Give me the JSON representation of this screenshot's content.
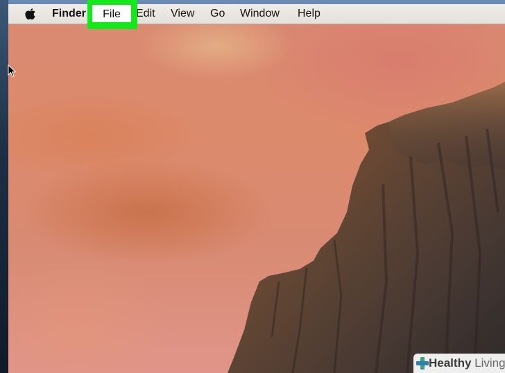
{
  "menubar": {
    "apple_icon": "apple-logo-icon",
    "app_name": "Finder",
    "items": [
      "File",
      "Edit",
      "View",
      "Go",
      "Window",
      "Help"
    ],
    "highlighted_item": "File",
    "highlight_color": "#12e81a"
  },
  "desktop": {
    "wallpaper_colors": [
      "#d98a72",
      "#e0958a",
      "#3a2a24"
    ]
  },
  "cursor": {
    "icon": "arrow-cursor-icon"
  },
  "watermark": {
    "brand_part1": "Healthy",
    "brand_part2": "Living",
    "icon": "plus-cross-icon"
  }
}
